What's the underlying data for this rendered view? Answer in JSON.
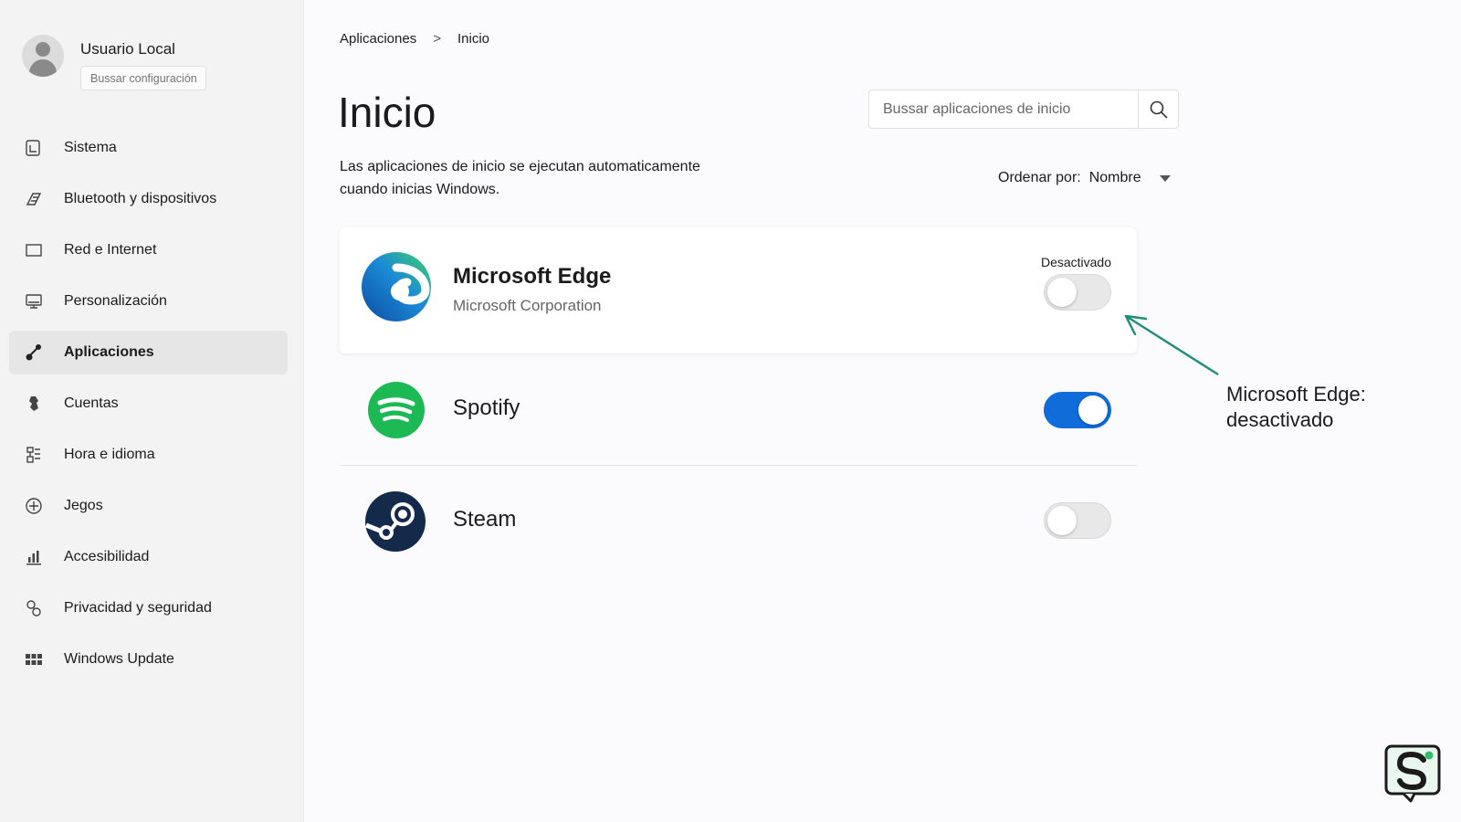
{
  "sidebar": {
    "user_name": "Usuario Local",
    "search_placeholder": "Bussar configuración",
    "items": [
      {
        "label": "Sistema",
        "icon": "system-icon"
      },
      {
        "label": "Bluetooth y dispositivos",
        "icon": "bluetooth-devices-icon"
      },
      {
        "label": "Red e Internet",
        "icon": "network-icon"
      },
      {
        "label": "Personalización",
        "icon": "personalization-icon"
      },
      {
        "label": "Aplicaciones",
        "icon": "apps-icon",
        "active": true
      },
      {
        "label": "Cuentas",
        "icon": "accounts-icon"
      },
      {
        "label": "Hora e idioma",
        "icon": "time-language-icon"
      },
      {
        "label": "Jegos",
        "icon": "gaming-icon"
      },
      {
        "label": "Accesibilidad",
        "icon": "accessibility-icon"
      },
      {
        "label": "Privacidad y seguridad",
        "icon": "privacy-icon"
      },
      {
        "label": "Windows Update",
        "icon": "windows-update-icon"
      }
    ]
  },
  "breadcrumb": {
    "parent": "Aplicaciones",
    "separator": ">",
    "current": "Inicio"
  },
  "page": {
    "title": "Inicio",
    "description": "Las aplicaciones de inicio se ejecutan automaticamente cuando inicias Windows."
  },
  "app_search": {
    "placeholder": "Bussar aplicaciones de inicio"
  },
  "sort": {
    "label": "Ordenar por:",
    "value": "Nombre"
  },
  "apps": [
    {
      "name": "Microsoft Edge",
      "publisher": "Microsoft Corporation",
      "status": "Desactivado",
      "enabled": false,
      "icon": "edge-logo-icon"
    },
    {
      "name": "Spotify",
      "enabled": true,
      "icon": "spotify-logo-icon"
    },
    {
      "name": "Steam",
      "enabled": false,
      "icon": "steam-logo-icon"
    }
  ],
  "annotation": {
    "line1": "Microsoft Edge:",
    "line2": "desactivado"
  },
  "colors": {
    "accent": "#0f6cd9",
    "arrow": "#1f8f7a",
    "spotify": "#1db954",
    "steam": "#132a4a"
  }
}
